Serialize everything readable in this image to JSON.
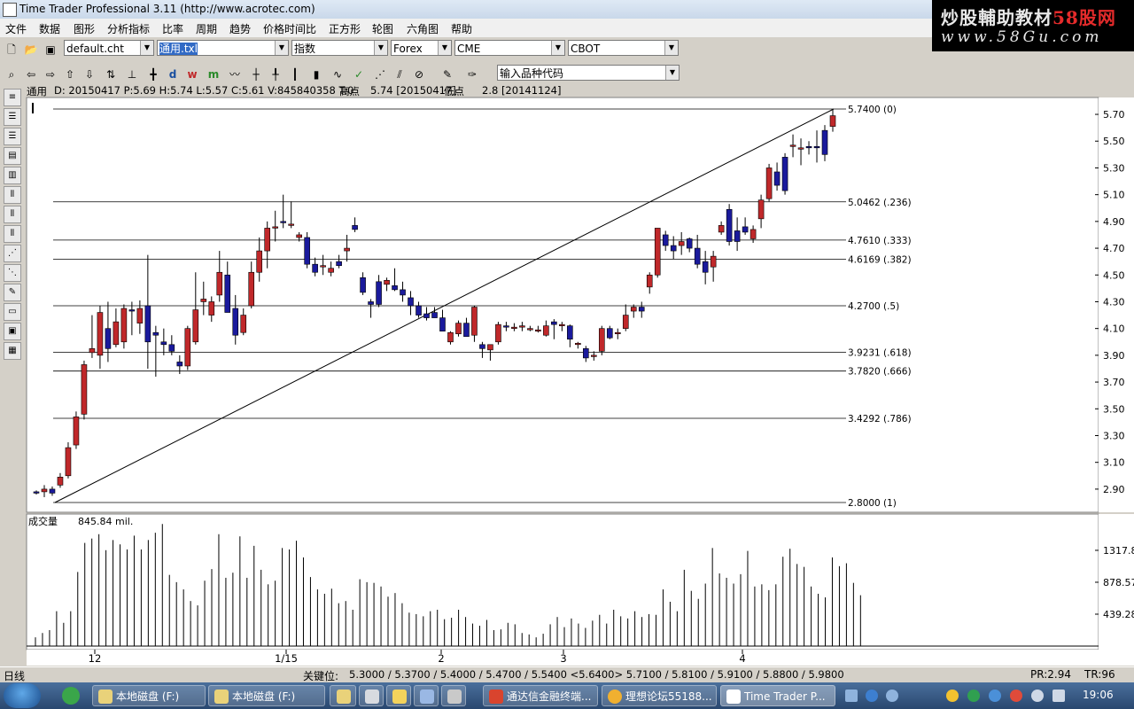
{
  "window": {
    "title": "Time Trader Professional 3.11 (http://www.acrotec.com)"
  },
  "banner": {
    "line1_a": "炒股輔助教材",
    "line1_b": "58股网",
    "line2": "www.58Gu.com"
  },
  "menu": [
    "文件",
    "数据",
    "图形",
    "分析指标",
    "比率",
    "周期",
    "趋势",
    "价格时间比",
    "正方形",
    "轮图",
    "六角图",
    "帮助"
  ],
  "toolbar1": {
    "chart_file": "default.cht",
    "template": "通用.txl",
    "index": "指数",
    "forex": "Forex",
    "cme": "CME",
    "cbot": "CBOT"
  },
  "toolbar2": {
    "symbol_placeholder": "输入品种代码",
    "icons": [
      "magnify-icon",
      "arrow-left-icon",
      "arrow-right-icon",
      "rotate-up-icon",
      "arrow-down-icon",
      "zoom-fit-icon",
      "scale-icon",
      "crosshair-icon",
      "day-icon",
      "week-icon",
      "month-icon",
      "line-chart-icon",
      "cursor-icon",
      "bar-icon",
      "candle-icon",
      "check-icon",
      "fan-icon",
      "parallel-icon",
      "eraser-icon",
      "pencil-icon",
      "pen-icon"
    ],
    "labels": {
      "day": "d",
      "week": "w",
      "month": "m"
    }
  },
  "info": {
    "series": "通用",
    "quote": "D: 20150417  P:5.69  H:5.74  L:5.57  C:5.61  V:845840358  T:0",
    "high_label": "高点",
    "high_value": "5.74 [20150417]",
    "low_label": "低点",
    "low_value": "2.8 [20141124]"
  },
  "volume": {
    "label": "成交量",
    "value": "845.84 mil."
  },
  "chart_data": {
    "type": "candlestick",
    "price_axis": {
      "ylim": [
        2.75,
        5.8
      ],
      "ticks": [
        2.9,
        3.1,
        3.3,
        3.5,
        3.7,
        3.9,
        4.1,
        4.3,
        4.5,
        4.7,
        4.9,
        5.1,
        5.3,
        5.5,
        5.7
      ]
    },
    "x_ticks": [
      "12",
      "1/15",
      "2",
      "3",
      "4"
    ],
    "fibonacci": [
      {
        "price": "5.7400",
        "ratio": "(0)"
      },
      {
        "price": "5.0462",
        "ratio": "(.236)"
      },
      {
        "price": "4.7610",
        "ratio": "(.333)"
      },
      {
        "price": "4.6169",
        "ratio": "(.382)"
      },
      {
        "price": "4.2700",
        "ratio": "(.5)"
      },
      {
        "price": "3.9231",
        "ratio": "(.618)"
      },
      {
        "price": "3.7820",
        "ratio": "(.666)"
      },
      {
        "price": "3.4292",
        "ratio": "(.786)"
      },
      {
        "price": "2.8000",
        "ratio": "(1)"
      }
    ],
    "trendline": {
      "from": 2.8,
      "to": 5.74
    },
    "candles": [
      [
        2.88,
        2.89,
        2.86,
        2.87
      ],
      [
        2.88,
        2.93,
        2.84,
        2.9
      ],
      [
        2.9,
        2.92,
        2.85,
        2.87
      ],
      [
        2.93,
        3.02,
        2.91,
        2.99
      ],
      [
        3.0,
        3.25,
        2.98,
        3.21
      ],
      [
        3.23,
        3.48,
        3.2,
        3.44
      ],
      [
        3.46,
        3.86,
        3.42,
        3.83
      ],
      [
        3.92,
        4.2,
        3.88,
        3.95
      ],
      [
        3.9,
        4.27,
        3.8,
        4.22
      ],
      [
        4.1,
        4.3,
        3.85,
        3.95
      ],
      [
        3.98,
        4.25,
        3.96,
        4.15
      ],
      [
        4.0,
        4.28,
        3.95,
        4.25
      ],
      [
        4.24,
        4.3,
        4.05,
        4.23
      ],
      [
        4.14,
        4.31,
        4.06,
        4.25
      ],
      [
        4.27,
        4.65,
        3.8,
        4.0
      ],
      [
        4.07,
        4.12,
        3.74,
        4.05
      ],
      [
        4.0,
        4.1,
        3.9,
        3.98
      ],
      [
        3.98,
        4.05,
        3.9,
        3.93
      ],
      [
        3.85,
        3.9,
        3.76,
        3.82
      ],
      [
        3.82,
        4.12,
        3.79,
        4.1
      ],
      [
        4.0,
        4.52,
        3.98,
        4.24
      ],
      [
        4.3,
        4.45,
        4.2,
        4.32
      ],
      [
        4.2,
        4.34,
        4.15,
        4.3
      ],
      [
        4.35,
        4.68,
        4.3,
        4.52
      ],
      [
        4.5,
        4.6,
        4.25,
        4.22
      ],
      [
        4.25,
        4.35,
        3.98,
        4.05
      ],
      [
        4.07,
        4.25,
        4.05,
        4.2
      ],
      [
        4.27,
        4.6,
        4.25,
        4.52
      ],
      [
        4.52,
        4.78,
        4.45,
        4.68
      ],
      [
        4.68,
        4.9,
        4.55,
        4.85
      ],
      [
        4.85,
        4.98,
        4.75,
        4.86
      ],
      [
        4.9,
        5.1,
        4.85,
        4.89
      ],
      [
        4.88,
        5.05,
        4.85,
        4.88
      ],
      [
        4.78,
        4.82,
        4.75,
        4.8
      ],
      [
        4.78,
        4.82,
        4.55,
        4.58
      ],
      [
        4.58,
        4.63,
        4.49,
        4.52
      ],
      [
        4.57,
        4.65,
        4.5,
        4.57
      ],
      [
        4.52,
        4.6,
        4.49,
        4.55
      ],
      [
        4.6,
        4.65,
        4.55,
        4.57
      ],
      [
        4.68,
        4.8,
        4.6,
        4.7
      ],
      [
        4.87,
        4.93,
        4.82,
        4.84
      ],
      [
        4.48,
        4.52,
        4.35,
        4.37
      ],
      [
        4.3,
        4.32,
        4.18,
        4.28
      ],
      [
        4.45,
        4.5,
        4.26,
        4.28
      ],
      [
        4.43,
        4.48,
        4.38,
        4.46
      ],
      [
        4.42,
        4.55,
        4.38,
        4.39
      ],
      [
        4.39,
        4.45,
        4.3,
        4.35
      ],
      [
        4.33,
        4.38,
        4.2,
        4.27
      ],
      [
        4.27,
        4.3,
        4.18,
        4.2
      ],
      [
        4.21,
        4.26,
        4.16,
        4.18
      ],
      [
        4.22,
        4.26,
        4.18,
        4.18
      ],
      [
        4.18,
        4.24,
        4.14,
        4.08
      ],
      [
        4.0,
        4.08,
        3.98,
        4.07
      ],
      [
        4.06,
        4.16,
        4.04,
        4.14
      ],
      [
        4.14,
        4.18,
        4.04,
        4.04
      ],
      [
        4.05,
        4.27,
        4.0,
        4.26
      ],
      [
        3.98,
        4.0,
        3.88,
        3.95
      ],
      [
        3.94,
        3.98,
        3.86,
        3.98
      ],
      [
        4.0,
        4.15,
        3.98,
        4.13
      ],
      [
        4.12,
        4.15,
        4.08,
        4.11
      ],
      [
        4.11,
        4.14,
        4.08,
        4.11
      ],
      [
        4.12,
        4.15,
        4.08,
        4.12
      ],
      [
        4.1,
        4.12,
        4.08,
        4.1
      ],
      [
        4.09,
        4.12,
        4.07,
        4.09
      ],
      [
        4.05,
        4.16,
        4.04,
        4.12
      ],
      [
        4.15,
        4.17,
        4.02,
        4.13
      ],
      [
        4.12,
        4.15,
        4.08,
        4.13
      ],
      [
        4.12,
        4.13,
        3.96,
        4.02
      ],
      [
        3.98,
        4.0,
        3.95,
        3.99
      ],
      [
        3.95,
        3.97,
        3.85,
        3.88
      ],
      [
        3.9,
        3.93,
        3.86,
        3.9
      ],
      [
        3.93,
        4.12,
        3.9,
        4.1
      ],
      [
        4.1,
        4.12,
        4.02,
        4.03
      ],
      [
        4.06,
        4.1,
        4.02,
        4.07
      ],
      [
        4.1,
        4.28,
        4.08,
        4.2
      ],
      [
        4.23,
        4.28,
        4.18,
        4.26
      ],
      [
        4.26,
        4.3,
        4.18,
        4.23
      ],
      [
        4.41,
        4.52,
        4.36,
        4.5
      ],
      [
        4.5,
        4.85,
        4.48,
        4.85
      ],
      [
        4.8,
        4.83,
        4.68,
        4.72
      ],
      [
        4.72,
        4.79,
        4.62,
        4.68
      ],
      [
        4.72,
        4.82,
        4.65,
        4.75
      ],
      [
        4.77,
        4.78,
        4.67,
        4.7
      ],
      [
        4.7,
        4.8,
        4.55,
        4.58
      ],
      [
        4.6,
        4.68,
        4.43,
        4.52
      ],
      [
        4.56,
        4.68,
        4.45,
        4.64
      ],
      [
        4.82,
        4.9,
        4.8,
        4.87
      ],
      [
        4.99,
        5.03,
        4.72,
        4.75
      ],
      [
        4.83,
        4.93,
        4.68,
        4.75
      ],
      [
        4.86,
        4.93,
        4.8,
        4.82
      ],
      [
        4.77,
        4.87,
        4.74,
        4.84
      ],
      [
        4.92,
        5.1,
        4.85,
        5.06
      ],
      [
        5.07,
        5.33,
        5.05,
        5.3
      ],
      [
        5.27,
        5.34,
        5.13,
        5.17
      ],
      [
        5.38,
        5.41,
        5.1,
        5.13
      ],
      [
        5.46,
        5.55,
        5.38,
        5.47
      ],
      [
        5.44,
        5.52,
        5.32,
        5.45
      ],
      [
        5.46,
        5.5,
        5.4,
        5.45
      ],
      [
        5.46,
        5.58,
        5.34,
        5.45
      ],
      [
        5.58,
        5.62,
        5.35,
        5.4
      ],
      [
        5.61,
        5.74,
        5.57,
        5.69
      ]
    ],
    "volume_axis": {
      "ticks": [
        "1317.85",
        "878.57",
        "439.28"
      ]
    },
    "volumes": [
      120,
      180,
      220,
      480,
      320,
      480,
      1020,
      1420,
      1480,
      1540,
      1320,
      1460,
      1400,
      1330,
      1520,
      1330,
      1460,
      1560,
      1680,
      980,
      880,
      780,
      620,
      560,
      900,
      1060,
      1540,
      940,
      1010,
      1510,
      940,
      1380,
      1050,
      850,
      900,
      1350,
      1330,
      1450,
      1220,
      950,
      780,
      720,
      790,
      590,
      620,
      500,
      920,
      880,
      870,
      820,
      680,
      730,
      590,
      460,
      440,
      410,
      480,
      500,
      370,
      390,
      500,
      400,
      310,
      280,
      360,
      220,
      230,
      320,
      300,
      180,
      160,
      120,
      170,
      300,
      400,
      260,
      380,
      310,
      250,
      350,
      430,
      310,
      500,
      410,
      380,
      480,
      400,
      440,
      430,
      780,
      610,
      480,
      1050,
      760,
      650,
      860,
      1350,
      1000,
      940,
      860,
      990,
      1310,
      820,
      850,
      770,
      850,
      1230,
      1340,
      1130,
      1090,
      820,
      720,
      670,
      1220,
      1100,
      1140,
      870,
      700
    ],
    "volume_max": 1720
  },
  "status": {
    "left": "日线",
    "key_label": "关键位:",
    "key_levels": "5.3000 / 5.3700 / 5.4000 / 5.4700 / 5.5400 <5.6400> 5.7100 / 5.8100 / 5.9100 / 5.8800 / 5.9800",
    "pr": "PR:2.94",
    "tr": "TR:96"
  },
  "taskbar": {
    "items": [
      "本地磁盘 (F:)",
      "本地磁盘 (F:)",
      "",
      "通达信金融终端...",
      "理想论坛55188...",
      "Time Trader P..."
    ],
    "clock": "19:06"
  }
}
